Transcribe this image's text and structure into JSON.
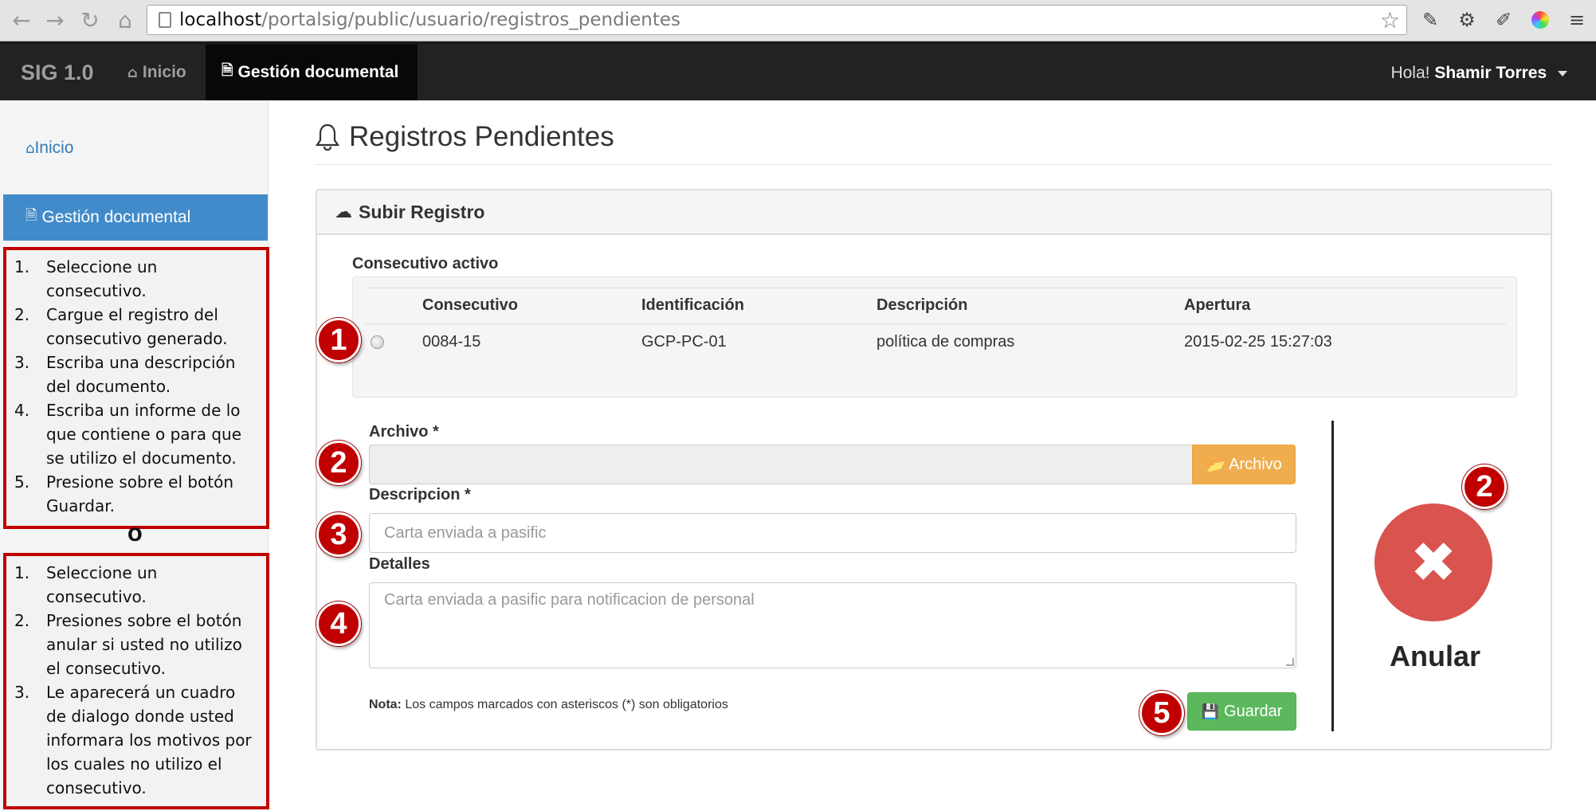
{
  "browser": {
    "url_host": "localhost",
    "url_path": "/portalsig/public/usuario/registros_pendientes"
  },
  "navbar": {
    "brand": "SIG 1.0",
    "items": [
      {
        "label": "Inicio",
        "icon": "home-icon"
      },
      {
        "label": "Gestión documental",
        "icon": "file-icon"
      }
    ],
    "greeting": "Hola!",
    "user_name": "Shamir Torres"
  },
  "sidebar": {
    "items": [
      {
        "label": "Inicio",
        "icon": "home-icon"
      },
      {
        "label": "Gestión documental",
        "icon": "file-icon"
      }
    ]
  },
  "instructions_upload": [
    {
      "num": "1.",
      "text": "Seleccione un consecutivo."
    },
    {
      "num": "2.",
      "text": "Cargue el registro del consecutivo generado."
    },
    {
      "num": "3.",
      "text": "Escriba una descripción del documento."
    },
    {
      "num": "4.",
      "text": "Escriba un informe de lo que contiene o para que se utilizo el documento."
    },
    {
      "num": "5.",
      "text": "Presione sobre el botón Guardar."
    }
  ],
  "instructions_or": "O",
  "instructions_cancel": [
    {
      "num": "1.",
      "text": "Seleccione un consecutivo."
    },
    {
      "num": "2.",
      "text": "Presiones sobre el botón anular si usted no utilizo el consecutivo."
    },
    {
      "num": "3.",
      "text": "Le aparecerá un cuadro de dialogo donde usted informara los motivos por los cuales no utilizo el consecutivo."
    }
  ],
  "page": {
    "title": "Registros Pendientes"
  },
  "panel": {
    "heading": "Subir Registro",
    "consecutivo_label": "Consecutivo activo",
    "table": {
      "headers": [
        "Consecutivo",
        "Identificación",
        "Descripción",
        "Apertura"
      ],
      "rows": [
        [
          "0084-15",
          "GCP-PC-01",
          "política de compras",
          "2015-02-25 15:27:03"
        ]
      ]
    },
    "archivo_label": "Archivo *",
    "archivo_button": "Archivo",
    "descripcion_label": "Descripcion *",
    "descripcion_placeholder": "Carta enviada a pasific",
    "detalles_label": "Detalles",
    "detalles_placeholder": "Carta enviada a pasific para notificacion de personal",
    "note_bold": "Nota:",
    "note_text": " Los campos marcados con asteriscos (*) son obligatorios",
    "save_button": "Guardar",
    "cancel_label": "Anular"
  },
  "step_markers": [
    "1",
    "2",
    "3",
    "4",
    "5",
    "2"
  ],
  "colors": {
    "navbar": "#222222",
    "sidebar_active": "#428bca",
    "warning_button": "#f0ad4e",
    "success_button": "#5cb85c",
    "danger_circle": "#d9534f",
    "annotation_red": "#c00000"
  }
}
